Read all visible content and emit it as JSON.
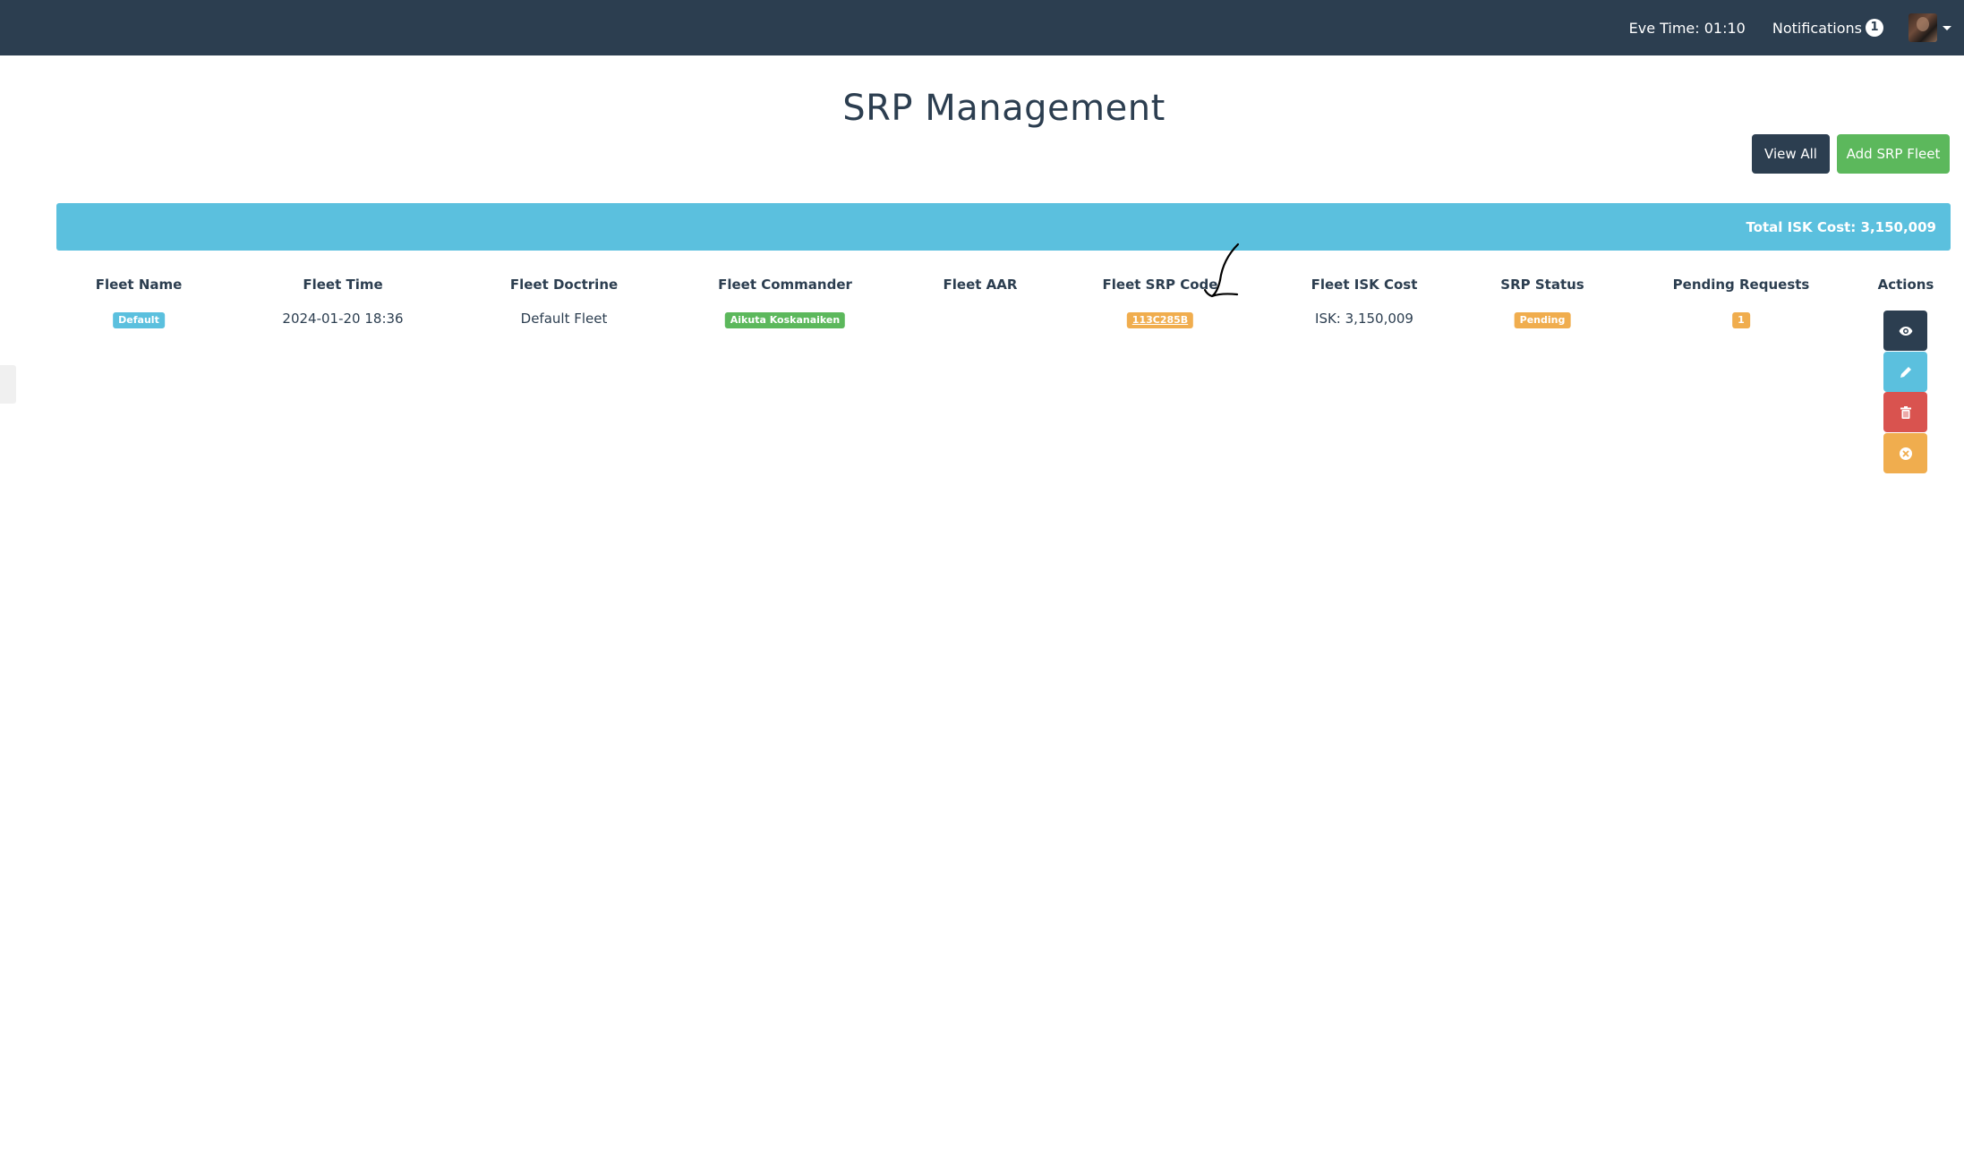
{
  "navbar": {
    "eve_time": "Eve Time: 01:10",
    "notifications_label": "Notifications",
    "notifications_count": "1"
  },
  "page": {
    "title": "SRP Management"
  },
  "toolbar": {
    "view_all_label": "View All",
    "add_fleet_label": "Add SRP Fleet"
  },
  "summary": {
    "total_isk": "Total ISK Cost: 3,150,009"
  },
  "table": {
    "headers": {
      "fleet_name": "Fleet Name",
      "fleet_time": "Fleet Time",
      "fleet_doctrine": "Fleet Doctrine",
      "fleet_commander": "Fleet Commander",
      "fleet_aar": "Fleet AAR",
      "fleet_srp_code": "Fleet SRP Code",
      "fleet_isk_cost": "Fleet ISK Cost",
      "srp_status": "SRP Status",
      "pending_requests": "Pending Requests",
      "actions": "Actions"
    },
    "rows": [
      {
        "fleet_name": "Default",
        "fleet_time": "2024-01-20 18:36",
        "fleet_doctrine": "Default Fleet",
        "fleet_commander": "Aikuta Koskanaiken",
        "fleet_aar": "",
        "fleet_srp_code": "113C285B",
        "fleet_isk_cost": "ISK: 3,150,009",
        "srp_status": "Pending",
        "pending_requests": "1"
      }
    ]
  },
  "icons": {
    "view": "eye-icon",
    "edit": "pencil-icon",
    "delete": "trash-icon",
    "close": "close-circle-icon",
    "avatar_menu": "caret-down-icon"
  },
  "colors": {
    "navbar": "#2c3e50",
    "info": "#5bc0de",
    "success": "#5cb85c",
    "warning": "#f0ad4e",
    "danger": "#d9534f"
  }
}
